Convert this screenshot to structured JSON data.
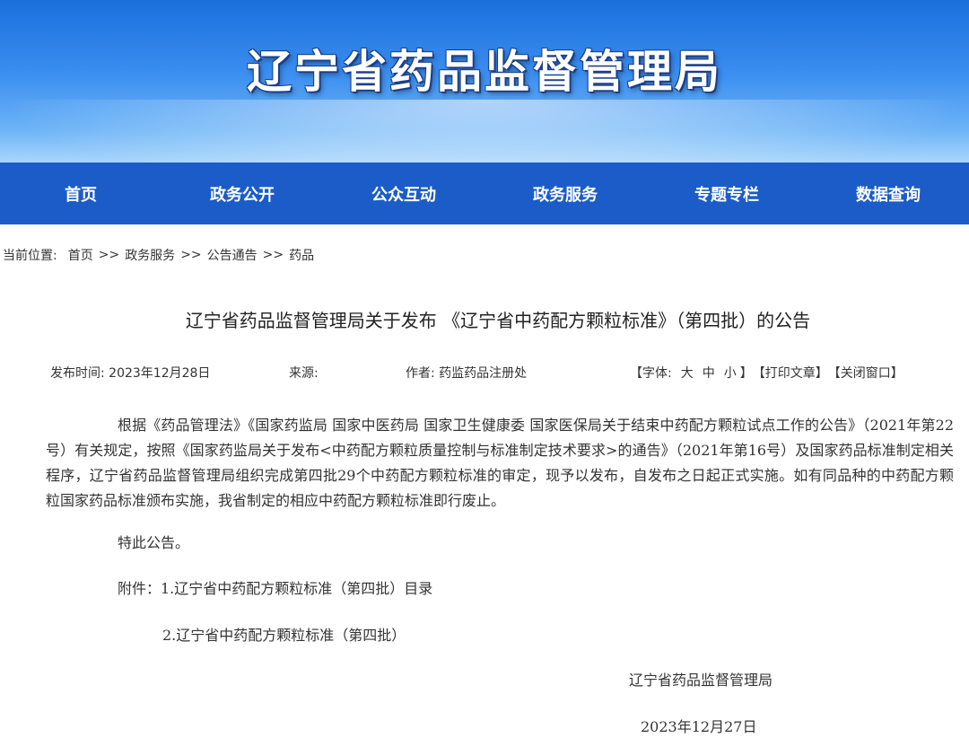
{
  "site": {
    "title": "辽宁省药品监督管理局"
  },
  "nav": {
    "items": [
      {
        "label": "首页"
      },
      {
        "label": "政务公开"
      },
      {
        "label": "公众互动"
      },
      {
        "label": "政务服务"
      },
      {
        "label": "专题专栏"
      },
      {
        "label": "数据查询"
      }
    ]
  },
  "breadcrumb": {
    "prefix": "当前位置:",
    "items": [
      "首页",
      "政务服务",
      "公告通告",
      "药品"
    ],
    "separator": ">>"
  },
  "article": {
    "title": "辽宁省药品监督管理局关于发布 《辽宁省中药配方颗粒标准》（第四批）的公告",
    "meta": {
      "date_label": "发布时间:",
      "date_value": "2023年12月28日",
      "source_label": "来源:",
      "source_value": "",
      "author_label": "作者:",
      "author_value": "药监药品注册处"
    },
    "tools": {
      "font_prefix": "【字体:",
      "font_large": "大",
      "font_medium": "中",
      "font_small": "小",
      "font_suffix": "】",
      "print": "【打印文章】",
      "close": "【关闭窗口】"
    },
    "body": "根据《药品管理法》《国家药监局 国家中医药局 国家卫生健康委 国家医保局关于结束中药配方颗粒试点工作的公告》（2021年第22号）有关规定，按照《国家药监局关于发布<中药配方颗粒质量控制与标准制定技术要求>的通告》（2021年第16号）及国家药品标准制定相关程序，辽宁省药品监督管理局组织完成第四批29个中药配方颗粒标准的审定，现予以发布，自发布之日起正式实施。如有同品种的中药配方颗粒国家药品标准颁布实施，我省制定的相应中药配方颗粒标准即行废止。",
    "special_notice": "特此公告。",
    "attachment_1": "附件：1.辽宁省中药配方颗粒标准（第四批）目录",
    "attachment_2": "2.辽宁省中药配方颗粒标准（第四批）",
    "signature_org": "辽宁省药品监督管理局",
    "signature_date": "2023年12月27日"
  },
  "colors": {
    "nav_bg": "#1b5cc8",
    "banner_top": "#1a6fdc",
    "banner_bottom": "#a9d6fb",
    "text": "#333333"
  }
}
